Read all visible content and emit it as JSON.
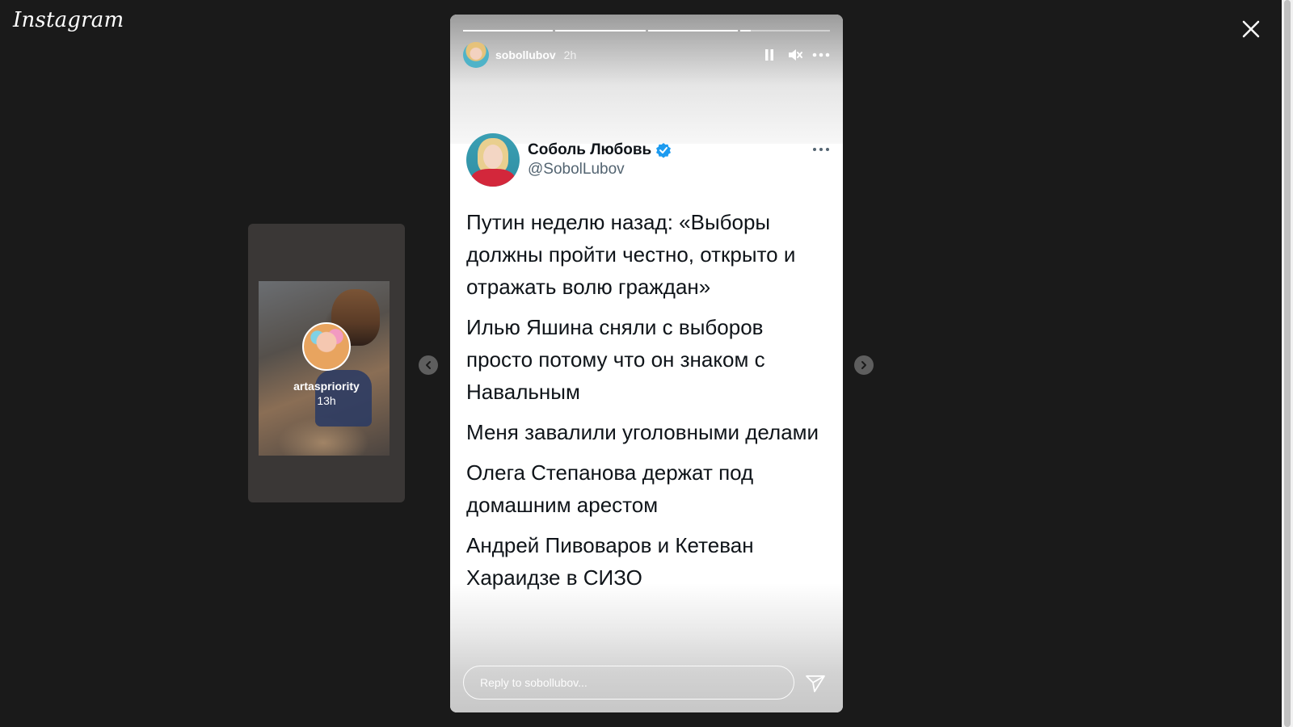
{
  "app": {
    "logo": "Instagram"
  },
  "icons": {
    "close": "close-icon",
    "prev": "chevron-left-icon",
    "next": "chevron-right-icon",
    "pause": "pause-icon",
    "mute": "muted-speaker-icon",
    "more": "more-horizontal-icon",
    "verified": "verified-badge-icon",
    "send": "send-icon"
  },
  "preview": {
    "username": "artaspriority",
    "time": "13h"
  },
  "story": {
    "username": "sobollubov",
    "time": "2h",
    "progress": [
      1,
      1,
      1,
      0.12
    ],
    "tweet": {
      "name": "Соболь Любовь",
      "handle": "@SobolLubov",
      "paragraphs": [
        "Путин неделю назад: «Выборы должны пройти честно, открыто и отражать волю граждан»",
        "Илью Яшина сняли с выборов просто потому что он знаком с Навальным",
        "Меня завалили уголовными делами",
        "Олега Степанова держат под домашним арестом",
        "Андрей Пивоваров и Кетеван Хараидзе в СИЗО"
      ]
    },
    "reply_placeholder": "Reply to sobollubov..."
  },
  "colors": {
    "background": "#1a1a1a",
    "verified": "#1d9bf0"
  }
}
